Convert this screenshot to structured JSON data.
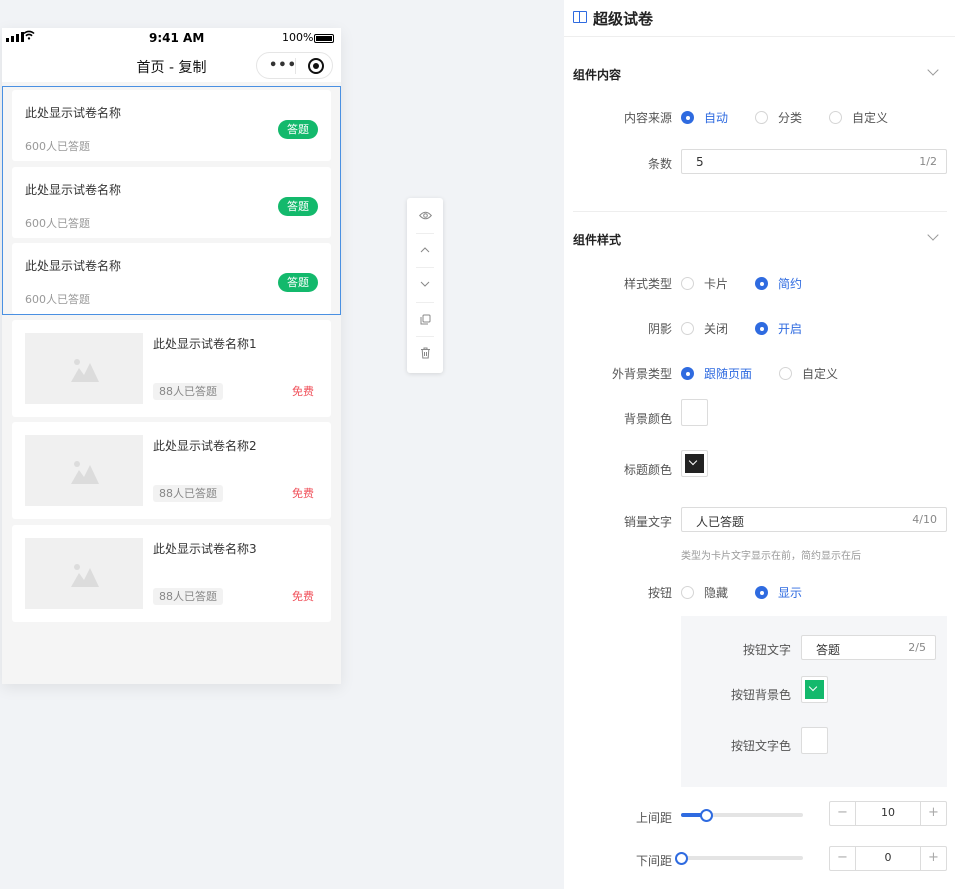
{
  "statusbar": {
    "time": "9:41 AM",
    "battery": "100%"
  },
  "navbar": {
    "title": "首页 - 复制",
    "more_icon": "more-dots-icon",
    "close_icon": "capsule-close-icon"
  },
  "exam_cards": [
    {
      "title": "此处显示试卷名称",
      "sales": "600人已答题",
      "button": "答题"
    },
    {
      "title": "此处显示试卷名称",
      "sales": "600人已答题",
      "button": "答题"
    },
    {
      "title": "此处显示试卷名称",
      "sales": "600人已答题",
      "button": "答题"
    }
  ],
  "list_items": [
    {
      "title": "此处显示试卷名称1",
      "sales": "88人已答题",
      "price": "免费"
    },
    {
      "title": "此处显示试卷名称2",
      "sales": "88人已答题",
      "price": "免费"
    },
    {
      "title": "此处显示试卷名称3",
      "sales": "88人已答题",
      "price": "免费"
    }
  ],
  "toolbar": [
    "eye-icon",
    "arrow-up-icon",
    "arrow-down-icon",
    "copy-icon",
    "delete-icon"
  ],
  "panel": {
    "title": "超级试卷",
    "content_section": {
      "title": "组件内容",
      "source": {
        "label": "内容来源",
        "options": [
          "自动",
          "分类",
          "自定义"
        ],
        "selected": "自动"
      },
      "count": {
        "label": "条数",
        "value": "5",
        "counter": "1/2"
      }
    },
    "style_section": {
      "title": "组件样式",
      "style_type": {
        "label": "样式类型",
        "options": [
          "卡片",
          "简约"
        ],
        "selected": "简约"
      },
      "shadow": {
        "label": "阴影",
        "options": [
          "关闭",
          "开启"
        ],
        "selected": "开启"
      },
      "bg_type": {
        "label": "外背景类型",
        "options": [
          "跟随页面",
          "自定义"
        ],
        "selected": "跟随页面"
      },
      "bg_color": {
        "label": "背景颜色",
        "color": "#ffffff"
      },
      "title_color": {
        "label": "标题颜色",
        "color": "#222222"
      },
      "sales_text": {
        "label": "销量文字",
        "value": "人已答题",
        "counter": "4/10",
        "hint": "类型为卡片文字显示在前，简约显示在后"
      },
      "button": {
        "label": "按钮",
        "options": [
          "隐藏",
          "显示"
        ],
        "selected": "显示"
      },
      "button_text": {
        "label": "按钮文字",
        "value": "答题",
        "counter": "2/5"
      },
      "button_bg": {
        "label": "按钮背景色",
        "color": "#13b96c"
      },
      "button_text_color": {
        "label": "按钮文字色",
        "color": "#ffffff"
      },
      "margin_top": {
        "label": "上间距",
        "value": "10"
      },
      "margin_bottom": {
        "label": "下间距",
        "value": "0"
      }
    }
  },
  "colors": {
    "accent": "#2f6be0",
    "green": "#13b96c",
    "price_red": "#f0505a"
  }
}
